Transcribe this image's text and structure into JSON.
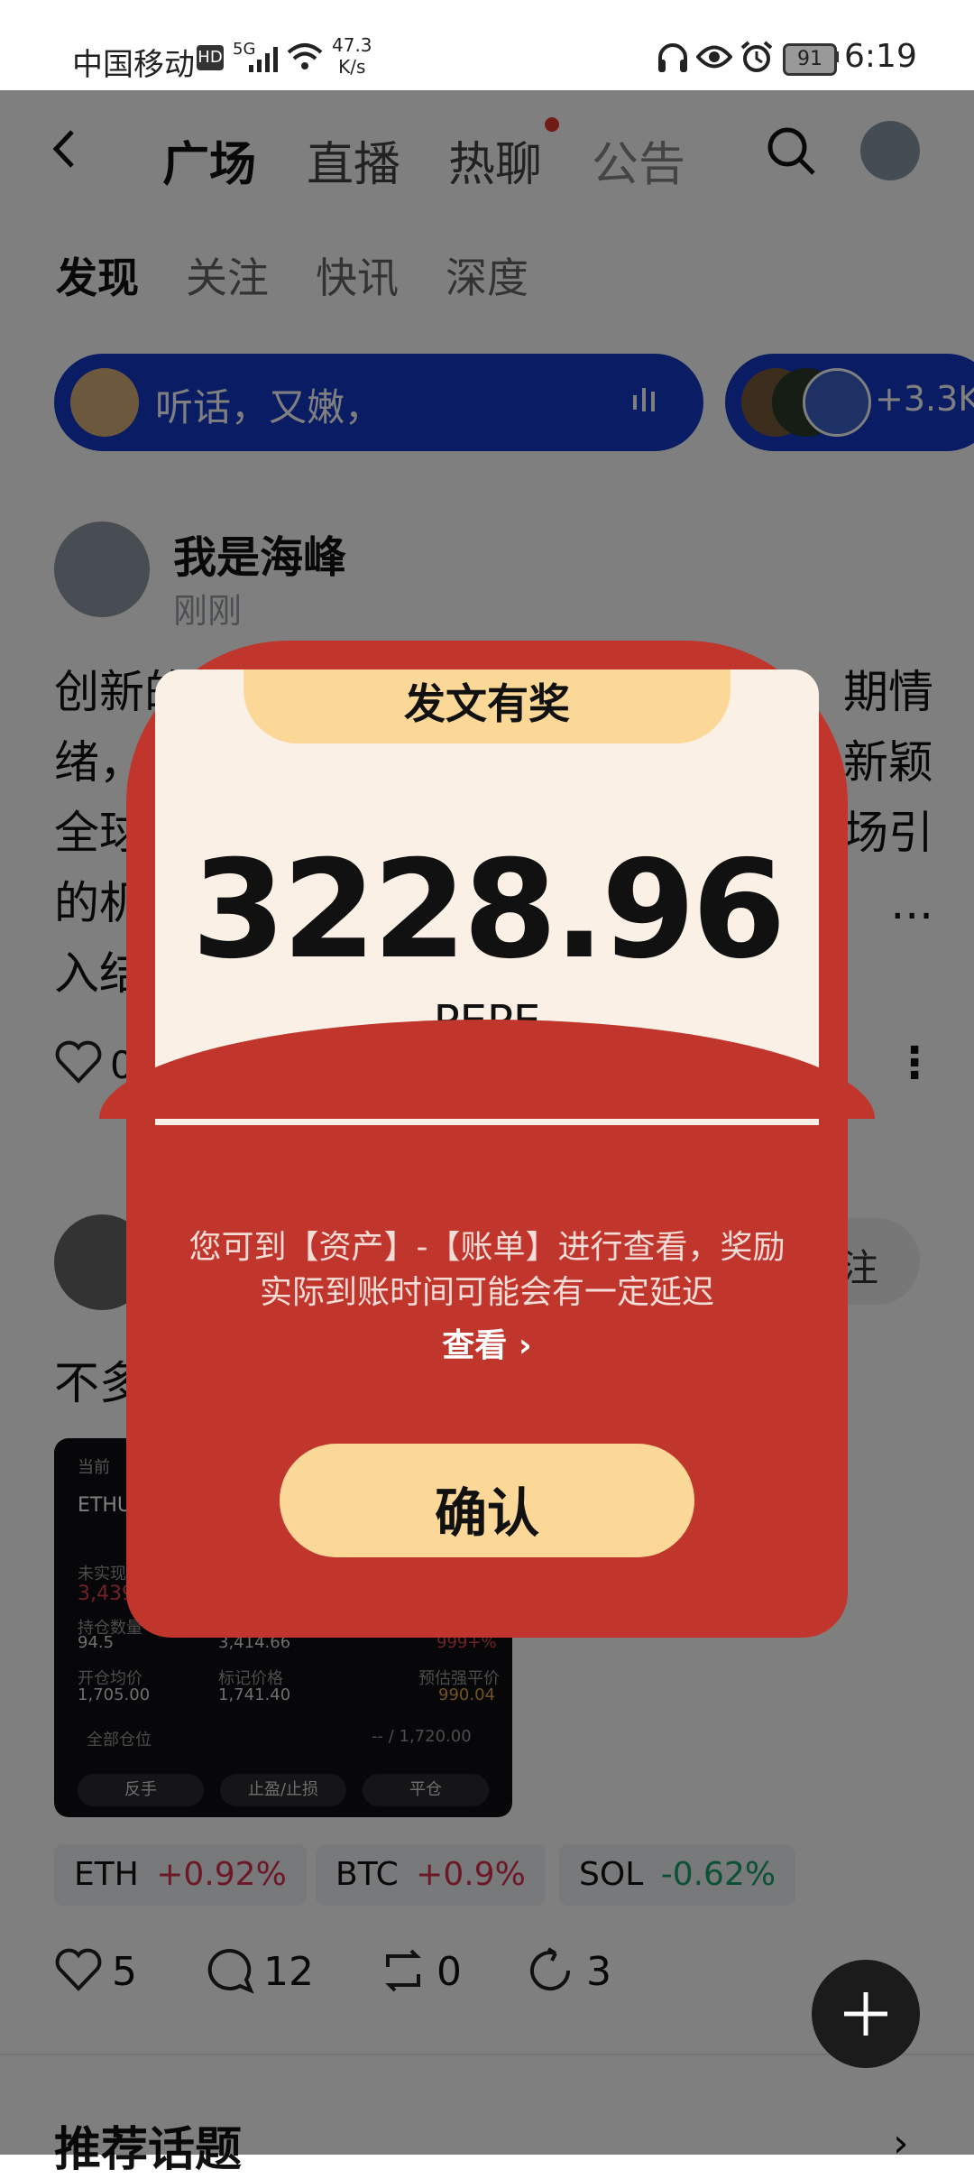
{
  "status_bar": {
    "carrier": "中国移动",
    "network": "5G",
    "speed_value": "47.3",
    "speed_unit": "K/s",
    "battery": "91",
    "time": "6:19"
  },
  "top_tabs": [
    "广场",
    "直播",
    "热聊",
    "公告"
  ],
  "sub_tabs": [
    "发现",
    "关注",
    "快讯",
    "深度"
  ],
  "live_chip": {
    "text": "听话，又嫩，",
    "count": "+3.3K"
  },
  "post1": {
    "author": "我是海峰",
    "time": "刚刚",
    "lines": [
      "创新的",
      "绪，",
      "全球",
      "的机",
      "入结"
    ],
    "lines_right": [
      "期情",
      "",
      "新颖",
      "场引",
      "..."
    ],
    "likes": "0"
  },
  "post2": {
    "prefix": "不多",
    "follow": "注",
    "card": {
      "row_top": "当前",
      "pair": "ETHU",
      "unrealized_label": "未实现",
      "unrealized_value": "3,439",
      "qty_label": "持仓数量",
      "qty_value": "94.5",
      "margin_value": "3,414.66",
      "roe_value": "999+%",
      "open_label": "开仓均价",
      "open_value": "1,705.00",
      "mark_label": "标记价格",
      "mark_value": "1,741.40",
      "liq_label": "预估强平价",
      "liq_value": "990.04",
      "all_label": "全部仓位",
      "all_value": "-- / 1,720.00",
      "btn1": "反手",
      "btn2": "止盈/止损",
      "btn3": "平仓"
    },
    "tags": [
      {
        "sym": "ETH",
        "chg": "+0.92%",
        "dir": "up"
      },
      {
        "sym": "BTC",
        "chg": "+0.9%",
        "dir": "up"
      },
      {
        "sym": "SOL",
        "chg": "-0.62%",
        "dir": "down"
      }
    ],
    "likes": "5",
    "comments": "12",
    "reposts": "0",
    "shares": "3"
  },
  "section_title": "推荐话题",
  "modal": {
    "badge": "发文有奖",
    "amount": "3228.96",
    "unit": "PEPE",
    "desc_line1": "您可到【资产】-【账单】进行查看，奖励",
    "desc_line2": "实际到账时间可能会有一定延迟",
    "link": "查看",
    "confirm": "确认"
  },
  "colors": {
    "up": "#d9304f",
    "down": "#1aa36a",
    "modal_red": "#c0362c",
    "modal_gold": "#fcd898",
    "chip_blue": "#1238c9"
  }
}
